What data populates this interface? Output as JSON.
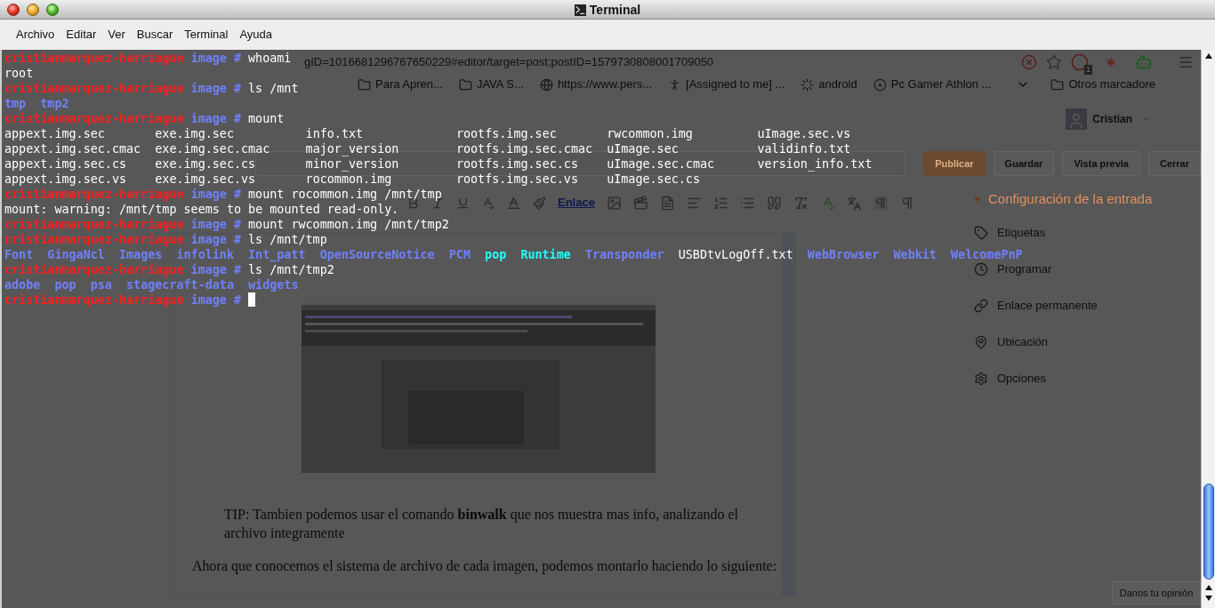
{
  "window": {
    "title": "Terminal"
  },
  "menu": [
    {
      "label": "Archivo"
    },
    {
      "label": "Editar"
    },
    {
      "label": "Ver"
    },
    {
      "label": "Buscar"
    },
    {
      "label": "Terminal"
    },
    {
      "label": "Ayuda"
    }
  ],
  "browser": {
    "url": "gID=1016681296767650229#editor/target=post;postID=1579730808001709050",
    "extension_badge": "1",
    "bookmarks": [
      {
        "label": "Para Apren...",
        "kind": "folder"
      },
      {
        "label": "JAVA S...",
        "kind": "folder"
      },
      {
        "label": "https://www.pers...",
        "kind": "site"
      },
      {
        "label": "[Assigned to me] ...",
        "kind": "person"
      },
      {
        "label": "android",
        "kind": "ring"
      },
      {
        "label": "Pc Gamer Athlon ...",
        "kind": "disc"
      },
      {
        "label": "Otros marcadore",
        "kind": "folder"
      }
    ],
    "user": "Cristian",
    "buttons": [
      {
        "label": "Publicar",
        "kind": "primary"
      },
      {
        "label": "Guardar",
        "kind": "plain"
      },
      {
        "label": "Vista previa",
        "kind": "plain"
      },
      {
        "label": "Cerrar",
        "kind": "plain"
      }
    ],
    "toolbar_link": "Enlace",
    "paragraphs": [
      {
        "kind": "indented",
        "text": "TIP: Tambien podemos usar el comando **binwalk** que nos muestra mas info, analizando el archivo integramente"
      },
      {
        "kind": "plain",
        "text": "Ahora que conocemos el sistema de archivo de cada imagen, podemos montarlo haciendo lo siguiente:"
      }
    ],
    "sidebar": {
      "title": "Configuración de la entrada",
      "items": [
        {
          "label": "Etiquetas",
          "kind": "tag"
        },
        {
          "label": "Programar",
          "kind": "clock"
        },
        {
          "label": "Enlace permanente",
          "kind": "link"
        },
        {
          "label": "Ubicación",
          "kind": "pin"
        },
        {
          "label": "Opciones",
          "kind": "gear"
        }
      ]
    },
    "feedback": "Danos tu opinión"
  },
  "terminal": {
    "lines": [
      {
        "kind": "prompt",
        "user": "cristianmarquez-harriague",
        "dir": "image",
        "symbol": "#",
        "command": "whoami"
      },
      {
        "kind": "output",
        "text": "root"
      },
      {
        "kind": "prompt",
        "user": "cristianmarquez-harriague",
        "dir": "image",
        "symbol": "#",
        "command": "ls /mnt"
      },
      {
        "kind": "listing",
        "entries": [
          {
            "name": "tmp",
            "kind": "dir"
          },
          {
            "name": "tmp2",
            "kind": "dir"
          }
        ]
      },
      {
        "kind": "prompt",
        "user": "cristianmarquez-harriague",
        "dir": "image",
        "symbol": "#",
        "command": "mount"
      },
      {
        "kind": "columns",
        "rows": [
          [
            "appext.img.sec",
            "exe.img.sec",
            "info.txt",
            "rootfs.img.sec",
            "rwcommon.img",
            "uImage.sec.vs"
          ],
          [
            "appext.img.sec.cmac",
            "exe.img.sec.cmac",
            "major_version",
            "rootfs.img.sec.cmac",
            "uImage.sec",
            "validinfo.txt"
          ],
          [
            "appext.img.sec.cs",
            "exe.img.sec.cs",
            "minor_version",
            "rootfs.img.sec.cs",
            "uImage.sec.cmac",
            "version_info.txt"
          ],
          [
            "appext.img.sec.vs",
            "exe.img.sec.vs",
            "rocommon.img",
            "rootfs.img.sec.vs",
            "uImage.sec.cs"
          ]
        ]
      },
      {
        "kind": "prompt",
        "user": "cristianmarquez-harriague",
        "dir": "image",
        "symbol": "#",
        "command": "mount rocommon.img /mnt/tmp"
      },
      {
        "kind": "output",
        "text": "mount: warning: /mnt/tmp seems to be mounted read-only."
      },
      {
        "kind": "prompt",
        "user": "cristianmarquez-harriague",
        "dir": "image",
        "symbol": "#",
        "command": "mount rwcommon.img /mnt/tmp2"
      },
      {
        "kind": "prompt",
        "user": "cristianmarquez-harriague",
        "dir": "image",
        "symbol": "#",
        "command": "ls /mnt/tmp"
      },
      {
        "kind": "listing",
        "entries": [
          {
            "name": "Font",
            "kind": "dir"
          },
          {
            "name": "GingaNcl",
            "kind": "dir"
          },
          {
            "name": "Images",
            "kind": "dir"
          },
          {
            "name": "infolink",
            "kind": "dir"
          },
          {
            "name": "Int_patt",
            "kind": "dir"
          },
          {
            "name": "OpenSourceNotice",
            "kind": "dir"
          },
          {
            "name": "PCM",
            "kind": "dir"
          },
          {
            "name": "pop",
            "kind": "link"
          },
          {
            "name": "Runtime",
            "kind": "link"
          },
          {
            "name": "Transponder",
            "kind": "dir"
          },
          {
            "name": "USBDtvLogOff.txt",
            "kind": "file"
          },
          {
            "name": "WebBrowser",
            "kind": "dir"
          },
          {
            "name": "Webkit",
            "kind": "dir"
          },
          {
            "name": "WelcomePnP",
            "kind": "dir"
          }
        ]
      },
      {
        "kind": "prompt",
        "user": "cristianmarquez-harriague",
        "dir": "image",
        "symbol": "#",
        "command": "ls /mnt/tmp2"
      },
      {
        "kind": "listing",
        "entries": [
          {
            "name": "adobe",
            "kind": "dir"
          },
          {
            "name": "pop",
            "kind": "dir"
          },
          {
            "name": "psa",
            "kind": "dir"
          },
          {
            "name": "stagecraft-data",
            "kind": "dir"
          },
          {
            "name": "widgets",
            "kind": "dir"
          }
        ]
      },
      {
        "kind": "prompt",
        "user": "cristianmarquez-harriague",
        "dir": "image",
        "symbol": "#",
        "cursor": true
      }
    ]
  }
}
